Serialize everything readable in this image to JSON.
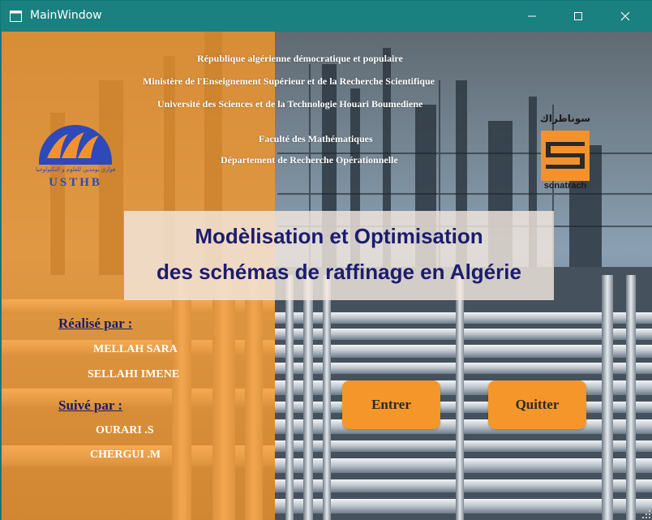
{
  "window": {
    "title": "MainWindow",
    "accent_color": "#1a8080"
  },
  "header": {
    "line1": "République algérienne démocratique et populaire",
    "line2": "Ministère de l'Enseignement Supérieur et de la Recherche Scientifique",
    "line3": "Université des Sciences et de la Technologie Houari Boumediene",
    "line4": "Faculté des Mathématiques",
    "line5": "Département de Recherche Opérationnelle"
  },
  "logos": {
    "university": {
      "icon": "usthb-logo",
      "arabic_text": "جامعة هواري بومدين للعلوم و التكنولوجيا",
      "text": "USTHB"
    },
    "company": {
      "icon": "sonatrach-logo",
      "arabic_text": "سوناطراك",
      "text": "sonatrach"
    }
  },
  "title": {
    "line1": "Modèlisation et Optimisation",
    "line2": "des schémas de raffinage en Algérie"
  },
  "credits": {
    "made_by_label": "Réalisé par :",
    "authors": [
      "MELLAH SARA",
      "SELLAHI IMENE"
    ],
    "supervised_by_label": "Suivé par :",
    "supervisors": [
      "OURARI .S",
      "CHERGUI .M"
    ]
  },
  "buttons": {
    "enter": "Entrer",
    "quit": "Quitter"
  },
  "colors": {
    "orange": "#f5962b",
    "navy_text": "#1c1c6e"
  }
}
